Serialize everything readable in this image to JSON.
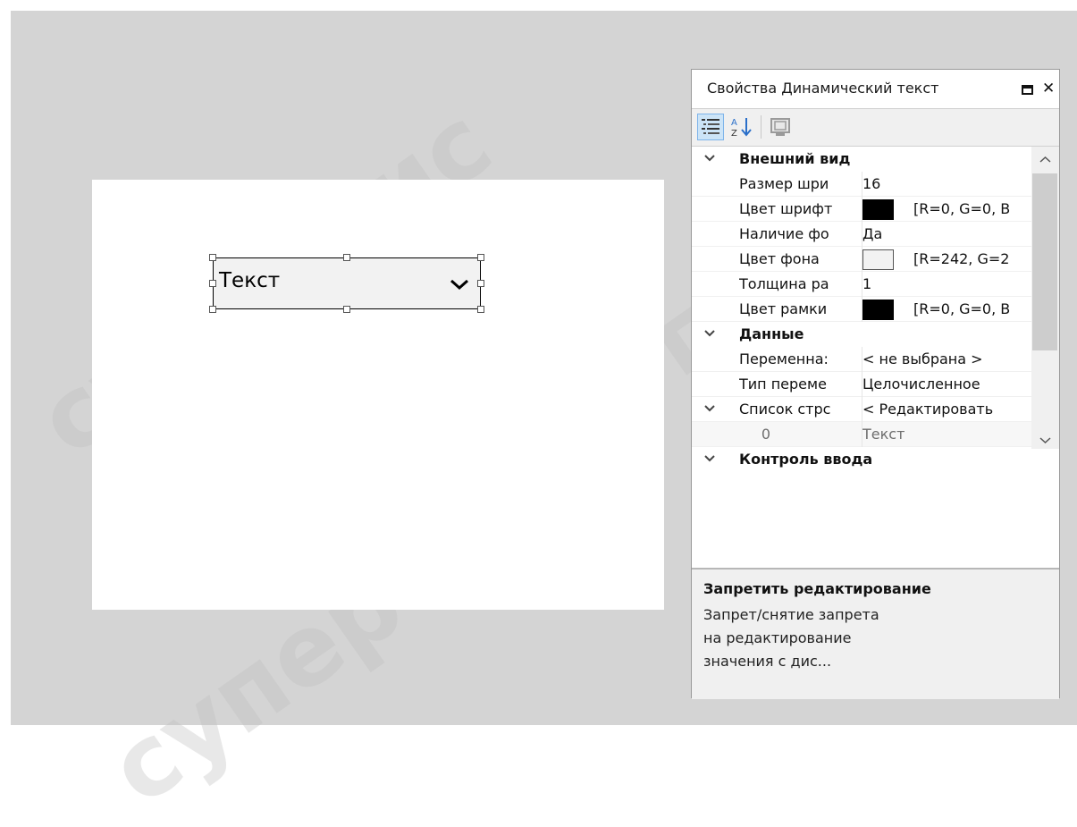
{
  "canvas": {
    "widget_text": "Текст"
  },
  "watermark": {
    "text": "супероис"
  },
  "panel": {
    "title": "Свойства Динамический текст",
    "toolbar": {
      "categorized_icon": "categorized-list-icon",
      "alphabetical_icon": "sort-az-icon",
      "pages_icon": "property-pages-icon"
    },
    "categories": [
      {
        "label": "Внешний вид",
        "properties": [
          {
            "name": "Размер шри",
            "value": "16"
          },
          {
            "name": "Цвет шрифт",
            "value": "[R=0, G=0, B",
            "swatch": "#000000"
          },
          {
            "name": "Наличие фо",
            "value": "Да"
          },
          {
            "name": "Цвет фона",
            "value": "[R=242, G=2",
            "swatch": "#f2f2f2"
          },
          {
            "name": "Толщина ра",
            "value": "1"
          },
          {
            "name": "Цвет рамки",
            "value": "[R=0, G=0, B",
            "swatch": "#000000"
          }
        ]
      },
      {
        "label": "Данные",
        "properties": [
          {
            "name": "Переменна:",
            "value": "< не выбрана >"
          },
          {
            "name": "Тип переме",
            "value": "Целочисленное"
          },
          {
            "name": "Список стрс",
            "value": "< Редактировать"
          },
          {
            "name": "0",
            "value": "Текст"
          }
        ]
      },
      {
        "label": "Контроль ввода"
      }
    ],
    "description": {
      "title": "Запретить редактирование",
      "body": "Запрет/снятие запрета на редактирование значения с дис..."
    }
  }
}
